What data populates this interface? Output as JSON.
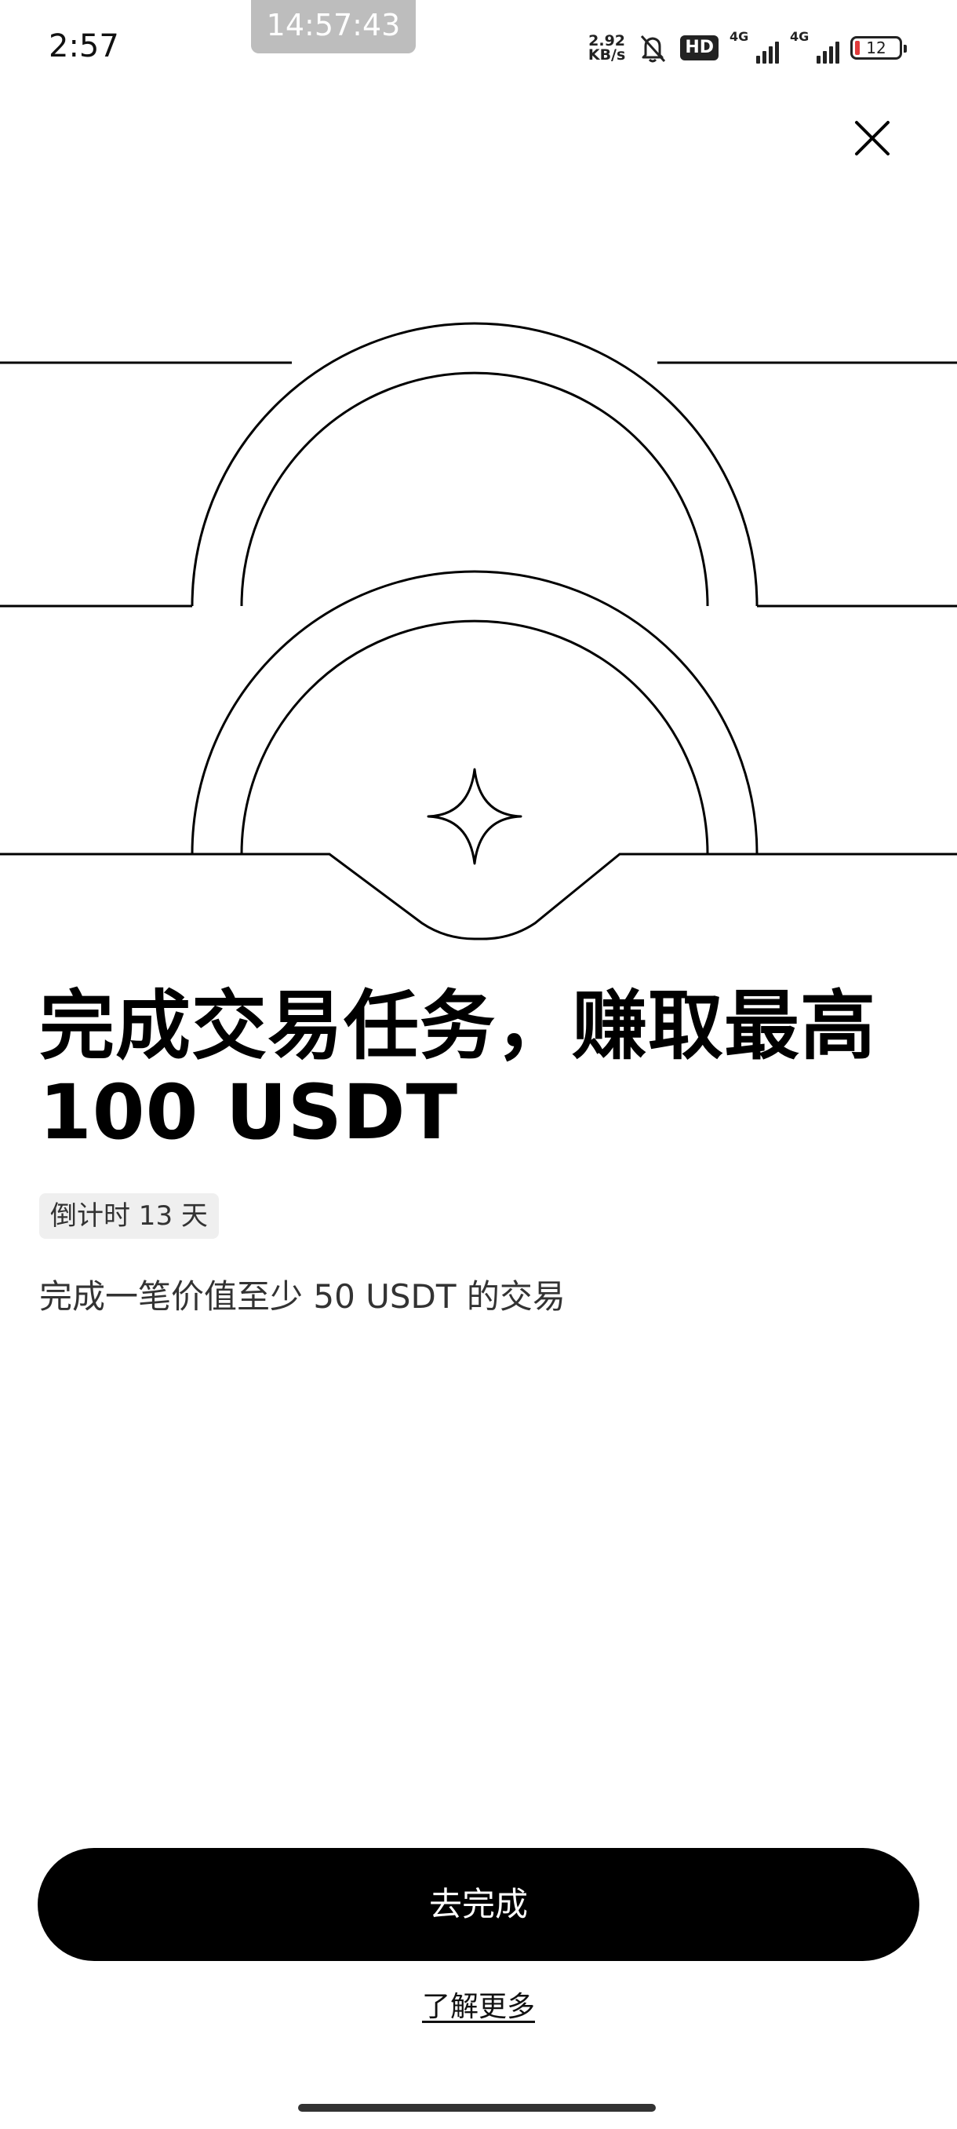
{
  "status_bar": {
    "time": "2:57",
    "record_time": "14:57:43",
    "net_speed_value": "2.92",
    "net_speed_unit": "KB/s",
    "hd_label": "HD",
    "signal1_label": "4G",
    "signal2_label": "4G",
    "battery_level": "12",
    "battery_color": "#e23b3b",
    "icons": [
      "bell-off-icon",
      "hd-icon",
      "signal-icon",
      "signal-icon",
      "battery-icon"
    ]
  },
  "header": {
    "close_icon": "close-icon"
  },
  "promo": {
    "title_line1": "完成交易任务，赚取最高",
    "title_line2": "100 USDT",
    "countdown": "倒计时 13 天",
    "description": "完成一笔价值至少 50 USDT 的交易"
  },
  "actions": {
    "primary_label": "去完成",
    "secondary_label": "了解更多"
  },
  "colors": {
    "primary_button_bg": "#000000",
    "primary_button_text": "#ffffff",
    "badge_bg": "#efefef"
  }
}
